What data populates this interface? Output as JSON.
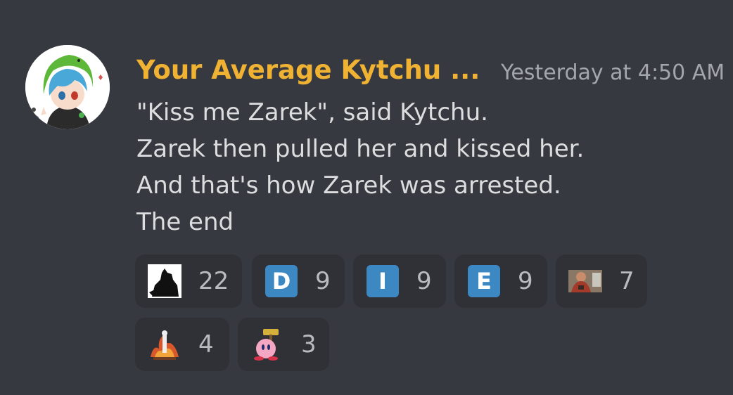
{
  "message": {
    "author": "Your Average Kytchu ...",
    "timestamp": "Yesterday at 4:50 AM",
    "lines": [
      "\"Kiss me Zarek\", said Kytchu.",
      "Zarek then pulled her and kissed her.",
      "And that's how Zarek was arrested.",
      "The end"
    ]
  },
  "reactions": [
    {
      "emoji": "silhouette-dog-emoji",
      "letter": "",
      "count": "22"
    },
    {
      "emoji": "regional-indicator-d-emoji",
      "letter": "D",
      "count": "9"
    },
    {
      "emoji": "regional-indicator-i-emoji",
      "letter": "I",
      "count": "9"
    },
    {
      "emoji": "regional-indicator-e-emoji",
      "letter": "E",
      "count": "9"
    },
    {
      "emoji": "heavy-soldier-emoji",
      "letter": "",
      "count": "7"
    },
    {
      "emoji": "flaming-skeleton-emoji",
      "letter": "",
      "count": "4"
    },
    {
      "emoji": "pink-ball-hammer-emoji",
      "letter": "",
      "count": "3"
    }
  ],
  "colors": {
    "background": "#36393f",
    "username": "#f0b232",
    "reaction_bg": "#2f3136",
    "regional_indicator": "#3b88c3"
  }
}
